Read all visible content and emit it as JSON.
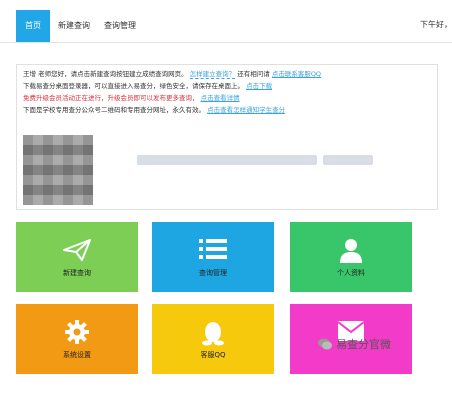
{
  "nav": {
    "tabs": [
      {
        "label": "首页"
      },
      {
        "label": "新建查询"
      },
      {
        "label": "查询管理"
      }
    ],
    "greeting": "下午好，"
  },
  "info": {
    "line1_a": "王增 老师您好，请点击新建查询按钮建立成绩查询网页。",
    "line1_link": "怎样建立查询？",
    "line1_b": "还有相问请",
    "line1_link2": "点击联系客服QQ",
    "line2_a": "下载易查分桌面登录器，可以直接进入易查分，绿色安全，请保存在桌面上。",
    "line2_link": "点击下载",
    "line3_a": "免费升级会员活动正在进行，升级会员即可以发布更多查询，",
    "line3_link": "点击查看详情",
    "line4_a": "下面是学校专用查分公众号二维码和专用查分网址，永久有效。",
    "line4_link": "点击查看怎样通知学生查分"
  },
  "tiles": [
    {
      "label": "新建查询",
      "icon": "paper-plane-icon",
      "color": "#7dce55"
    },
    {
      "label": "查询管理",
      "icon": "list-icon",
      "color": "#1ea6e3"
    },
    {
      "label": "个人资料",
      "icon": "user-icon",
      "color": "#39c66b"
    },
    {
      "label": "系统设置",
      "icon": "gear-icon",
      "color": "#f29a13"
    },
    {
      "label": "客服QQ",
      "icon": "qq-penguin-icon",
      "color": "#f6c90d"
    },
    {
      "label": "",
      "icon": "mail-icon",
      "color": "#f23bc8"
    }
  ],
  "watermark": "易查分官微"
}
